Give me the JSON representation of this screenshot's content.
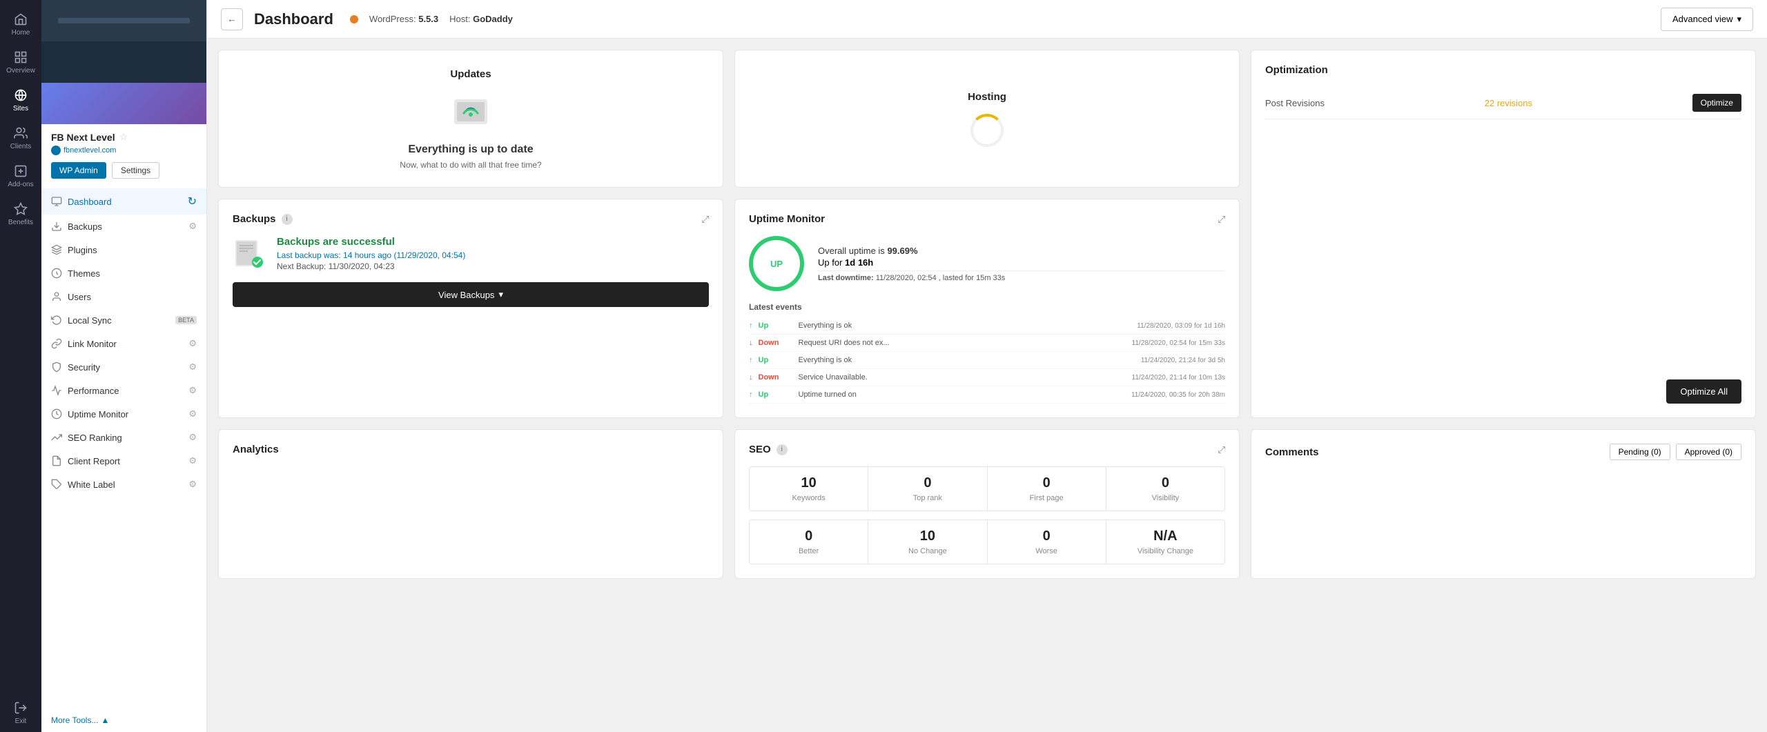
{
  "nav": {
    "items": [
      {
        "id": "home",
        "label": "Home",
        "icon": "home"
      },
      {
        "id": "overview",
        "label": "Overview",
        "icon": "overview"
      },
      {
        "id": "sites",
        "label": "Sites",
        "icon": "sites",
        "active": true
      },
      {
        "id": "clients",
        "label": "Clients",
        "icon": "clients"
      },
      {
        "id": "add-ons",
        "label": "Add-ons",
        "icon": "addons"
      },
      {
        "id": "benefits",
        "label": "Benefits",
        "icon": "benefits"
      },
      {
        "id": "exit",
        "label": "Exit",
        "icon": "exit"
      }
    ]
  },
  "site": {
    "name": "FB Next Level",
    "url": "fbnextlevel.com",
    "wp_admin_label": "WP Admin",
    "settings_label": "Settings"
  },
  "sidebar": {
    "items": [
      {
        "id": "dashboard",
        "label": "Dashboard",
        "icon": "monitor",
        "active": true,
        "has_refresh": true
      },
      {
        "id": "backups",
        "label": "Backups",
        "icon": "backup",
        "has_gear": true
      },
      {
        "id": "plugins",
        "label": "Plugins",
        "icon": "plugin"
      },
      {
        "id": "themes",
        "label": "Themes",
        "icon": "theme"
      },
      {
        "id": "users",
        "label": "Users",
        "icon": "user"
      },
      {
        "id": "local-sync",
        "label": "Local Sync",
        "icon": "sync",
        "beta": true
      },
      {
        "id": "link-monitor",
        "label": "Link Monitor",
        "icon": "link",
        "has_gear": true
      },
      {
        "id": "security",
        "label": "Security",
        "icon": "security",
        "has_gear": true
      },
      {
        "id": "performance",
        "label": "Performance",
        "icon": "performance",
        "has_gear": true
      },
      {
        "id": "uptime-monitor",
        "label": "Uptime Monitor",
        "icon": "uptime",
        "has_gear": true
      },
      {
        "id": "seo-ranking",
        "label": "SEO Ranking",
        "icon": "seo",
        "has_gear": true
      },
      {
        "id": "client-report",
        "label": "Client Report",
        "icon": "report",
        "has_gear": true
      },
      {
        "id": "white-label",
        "label": "White Label",
        "icon": "label",
        "has_gear": true
      }
    ],
    "more_tools": "More Tools..."
  },
  "header": {
    "title": "Dashboard",
    "back_label": "←",
    "wordpress_label": "WordPress:",
    "wordpress_version": "5.5.3",
    "host_label": "Host:",
    "host_name": "GoDaddy",
    "advanced_view_label": "Advanced view"
  },
  "updates_card": {
    "title": "Updates",
    "status": "Everything is up to date",
    "subtitle": "Now, what to do with all that free time?"
  },
  "hosting_card": {
    "title": "Hosting"
  },
  "optimization_card": {
    "title": "Optimization",
    "rows": [
      {
        "label": "Post Revisions",
        "value": "22 revisions",
        "btn_label": "Optimize"
      }
    ],
    "optimize_all_label": "Optimize All"
  },
  "backups_card": {
    "title": "Backups",
    "success_label": "Backups are successful",
    "last_backup_prefix": "Last backup was: 14 hours ago",
    "last_backup_date": "(11/29/2020, 04:54)",
    "next_backup": "Next Backup: 11/30/2020, 04:23",
    "view_backups_label": "View Backups"
  },
  "uptime_card": {
    "title": "Uptime Monitor",
    "circle_label": "UP",
    "overall_prefix": "Overall uptime is",
    "overall_value": "99.69%",
    "up_for_prefix": "Up for",
    "up_for_value": "1d 16h",
    "last_downtime_label": "Last downtime:",
    "last_downtime_value": "11/28/2020, 02:54",
    "lasted_label": ", lasted for 15m 33s",
    "events_title": "Latest events",
    "events": [
      {
        "direction": "up",
        "label": "Up",
        "desc": "Everything is ok",
        "time": "11/28/2020, 03:09 for 1d 16h"
      },
      {
        "direction": "down",
        "label": "Down",
        "desc": "Request URI does not ex...",
        "time": "11/28/2020, 02:54 for 15m 33s"
      },
      {
        "direction": "up",
        "label": "Up",
        "desc": "Everything is ok",
        "time": "11/24/2020, 21:24 for 3d 5h"
      },
      {
        "direction": "down",
        "label": "Down",
        "desc": "Service Unavailable.",
        "time": "11/24/2020, 21:14 for 10m 13s"
      },
      {
        "direction": "up",
        "label": "Up",
        "desc": "Uptime turned on",
        "time": "11/24/2020, 00:35 for 20h 38m"
      }
    ]
  },
  "seo_card": {
    "title": "SEO",
    "row1": [
      {
        "value": "10",
        "label": "Keywords"
      },
      {
        "value": "0",
        "label": "Top rank"
      },
      {
        "value": "0",
        "label": "First page"
      },
      {
        "value": "0",
        "label": "Visibility"
      }
    ],
    "row2": [
      {
        "value": "0",
        "label": "Better"
      },
      {
        "value": "10",
        "label": "No Change"
      },
      {
        "value": "0",
        "label": "Worse"
      },
      {
        "value": "N/A",
        "label": "Visibility Change"
      }
    ]
  },
  "comments_card": {
    "title": "Comments",
    "tabs": [
      {
        "label": "Pending (0)",
        "active": false
      },
      {
        "label": "Approved (0)",
        "active": false
      }
    ]
  },
  "analytics_card": {
    "title": "Analytics"
  }
}
